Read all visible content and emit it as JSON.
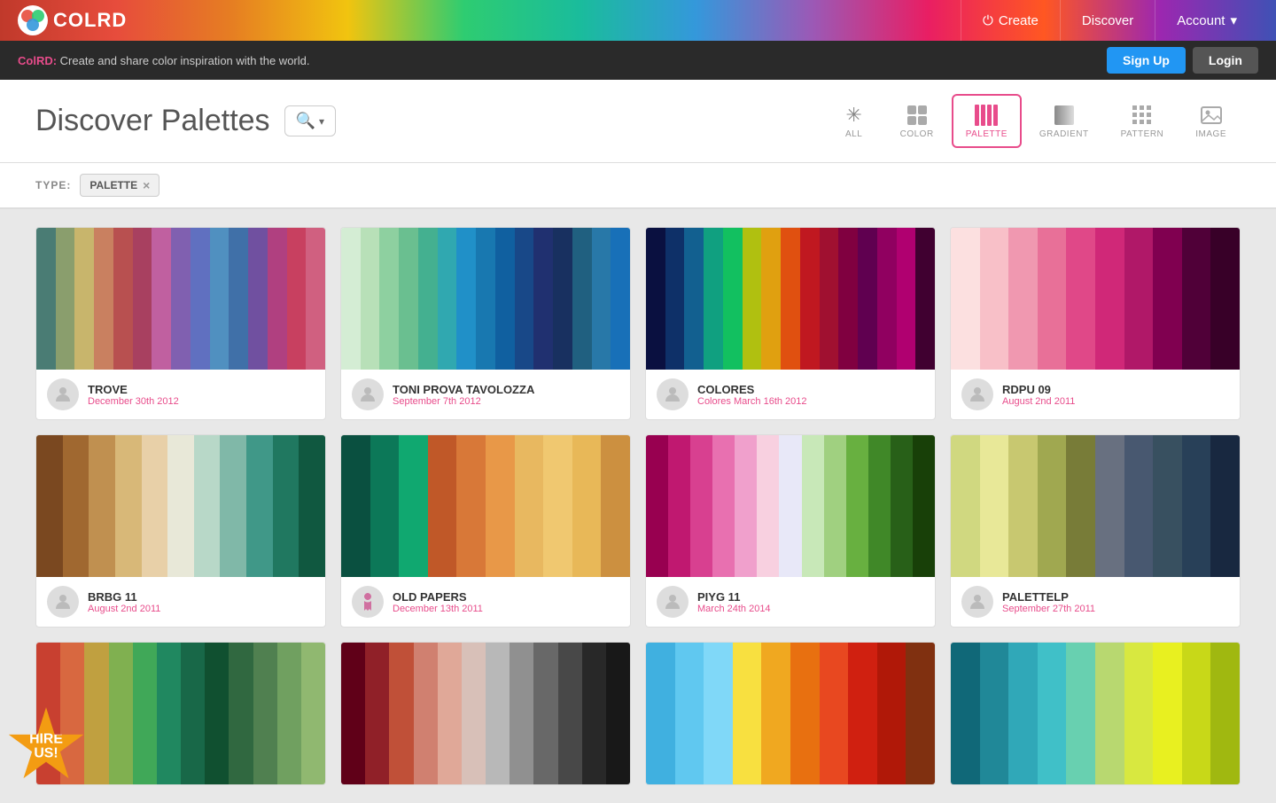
{
  "header": {
    "logo_text": "COLRD",
    "nav": [
      {
        "label": "Create",
        "icon": "power-icon"
      },
      {
        "label": "Discover",
        "icon": null
      },
      {
        "label": "Account",
        "icon": "chevron-down-icon"
      }
    ]
  },
  "promo": {
    "text_bold": "ColRD:",
    "text": "Create and share color inspiration with the world.",
    "signup_label": "Sign Up",
    "login_label": "Login"
  },
  "page": {
    "title": "Discover Palettes",
    "search_placeholder": "Search..."
  },
  "filter_tabs": [
    {
      "id": "all",
      "label": "ALL",
      "active": false
    },
    {
      "id": "color",
      "label": "COLOR",
      "active": false
    },
    {
      "id": "palette",
      "label": "PALETTE",
      "active": true
    },
    {
      "id": "gradient",
      "label": "GRADIENT",
      "active": false
    },
    {
      "id": "pattern",
      "label": "PATTERN",
      "active": false
    },
    {
      "id": "image",
      "label": "IMAGE",
      "active": false
    }
  ],
  "type_filter": {
    "label": "TYPE:",
    "tag": "PALETTE"
  },
  "palettes": [
    {
      "name": "TROVE",
      "date": "December 30th 2012",
      "sub": "",
      "swatches": [
        "#4a7c74",
        "#8a9e6d",
        "#c8b56c",
        "#c98060",
        "#b85050",
        "#a84060",
        "#c060a0",
        "#8060b0",
        "#6070c0",
        "#5090c0",
        "#4070a8",
        "#7050a0",
        "#b04080",
        "#c84060",
        "#d06080"
      ]
    },
    {
      "name": "TONI PROVA TAVOLOZZA",
      "date": "September 7th 2012",
      "sub": "",
      "swatches": [
        "#d4edd4",
        "#b8e0b8",
        "#8ed0a0",
        "#6abf90",
        "#44b090",
        "#30a8b0",
        "#2090c8",
        "#1878b0",
        "#1060a0",
        "#184888",
        "#203070",
        "#183060",
        "#206080",
        "#2878a8",
        "#1870b8"
      ]
    },
    {
      "name": "COLORES",
      "date": "March 16th 2012",
      "sub": "Colores",
      "swatches": [
        "#0a1040",
        "#0e3068",
        "#126090",
        "#10a080",
        "#12c060",
        "#b0c010",
        "#e0a010",
        "#e05010",
        "#c01820",
        "#a01030",
        "#800040",
        "#600050",
        "#900060",
        "#b00070",
        "#400030"
      ]
    },
    {
      "name": "RDPU 09",
      "date": "August 2nd 2011",
      "sub": "",
      "swatches": [
        "#fce0e0",
        "#f8c0c8",
        "#f098b0",
        "#e87098",
        "#e04888",
        "#d02878",
        "#b01868",
        "#800050",
        "#500038",
        "#380028"
      ]
    },
    {
      "name": "BRBG 11",
      "date": "August 2nd 2011",
      "sub": "",
      "swatches": [
        "#7a4820",
        "#a06830",
        "#c09050",
        "#d8b878",
        "#e8d0a8",
        "#e8e8d8",
        "#b8d8c8",
        "#80b8a8",
        "#409888",
        "#207860",
        "#105840"
      ]
    },
    {
      "name": "OLD PAPERS",
      "date": "December 13th 2011",
      "sub": "",
      "swatches": [
        "#0a5040",
        "#0c7858",
        "#10a870",
        "#c05828",
        "#d87838",
        "#e89848",
        "#e8b860",
        "#f0c870",
        "#e8b858",
        "#cc9040"
      ]
    },
    {
      "name": "PIYG 11",
      "date": "March 24th 2014",
      "sub": "",
      "swatches": [
        "#980050",
        "#c01870",
        "#d84090",
        "#e870b0",
        "#f0a0cc",
        "#f8d0e0",
        "#e8e8f8",
        "#c8e8b8",
        "#a0d080",
        "#68b040",
        "#408828",
        "#286018",
        "#184008"
      ]
    },
    {
      "name": "PALETTELP",
      "date": "September 27th 2011",
      "sub": "",
      "swatches": [
        "#d0d880",
        "#e8e898",
        "#c8c870",
        "#a0a850",
        "#787c38",
        "#687080",
        "#485870",
        "#385060",
        "#284058",
        "#182840"
      ]
    },
    {
      "name": "",
      "date": "",
      "sub": "",
      "swatches": [
        "#c84030",
        "#d86840",
        "#c0a040",
        "#80b050",
        "#40a858",
        "#208860",
        "#186848",
        "#105030",
        "#306840",
        "#508050",
        "#70a060",
        "#90b870"
      ]
    },
    {
      "name": "",
      "date": "",
      "sub": "",
      "swatches": [
        "#600018",
        "#902028",
        "#c05038",
        "#d08070",
        "#e0a898",
        "#d8c0b8",
        "#b8b8b8",
        "#909090",
        "#686868",
        "#484848",
        "#282828",
        "#181818"
      ]
    },
    {
      "name": "",
      "date": "",
      "sub": "",
      "swatches": [
        "#40b0e0",
        "#60c8f0",
        "#80d8f8",
        "#f8e040",
        "#f0a820",
        "#e87010",
        "#e84820",
        "#d02010",
        "#b01808",
        "#803010"
      ]
    },
    {
      "name": "",
      "date": "",
      "sub": "",
      "swatches": [
        "#106878",
        "#208898",
        "#30a8b8",
        "#40c0c8",
        "#68d0b0",
        "#b8d870",
        "#d8e840",
        "#e8f020",
        "#c8d818",
        "#a0b810"
      ]
    }
  ],
  "hire_badge": "HIRE\nUS!"
}
